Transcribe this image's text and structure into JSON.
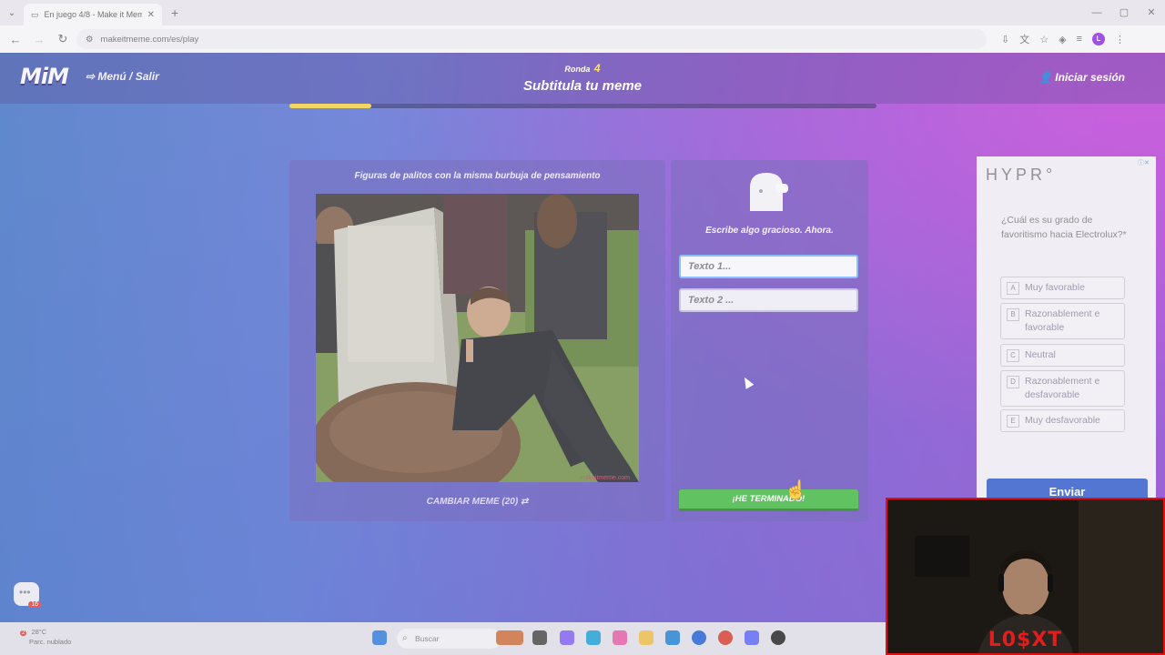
{
  "browser": {
    "tab_title": "En juego 4/8 - Make it Meme",
    "url": "makeitmeme.com/es/play",
    "profile_initial": "L"
  },
  "header": {
    "logo": "MiM",
    "menu_label": "Menú / Salir",
    "round_label": "Ronda",
    "round_number": "4",
    "subtitle": "Subtitula tu meme",
    "login_label": "Iniciar sesión",
    "progress_fraction": 0.14
  },
  "meme": {
    "title": "Figuras de palitos con la misma burbuja de pensamiento",
    "watermark": "makeitmeme.com",
    "change_label": "CAMBIAR MEME (20)"
  },
  "caption": {
    "prompt": "Escribe algo gracioso. Ahora.",
    "text1_placeholder": "Texto 1...",
    "text2_placeholder": "Texto 2 ...",
    "done_label": "¡HE TERMINADO!"
  },
  "ad": {
    "brand": "HYPR°",
    "question": "¿Cuál es su grado de favoritismo hacia Electrolux?*",
    "options": [
      {
        "key": "A",
        "label": "Muy favorable"
      },
      {
        "key": "B",
        "label": "Razonablement e favorable"
      },
      {
        "key": "C",
        "label": "Neutral"
      },
      {
        "key": "D",
        "label": "Razonablement e desfavorable"
      },
      {
        "key": "E",
        "label": "Muy desfavorable"
      }
    ],
    "send_label": "Enviar"
  },
  "notification_badge": "16",
  "taskbar": {
    "weather_temp": "28°C",
    "weather_desc": "Parc. nublado",
    "weather_alert": "2",
    "search_label": "Buscar"
  },
  "webcam": {
    "name": "L0$XT"
  }
}
